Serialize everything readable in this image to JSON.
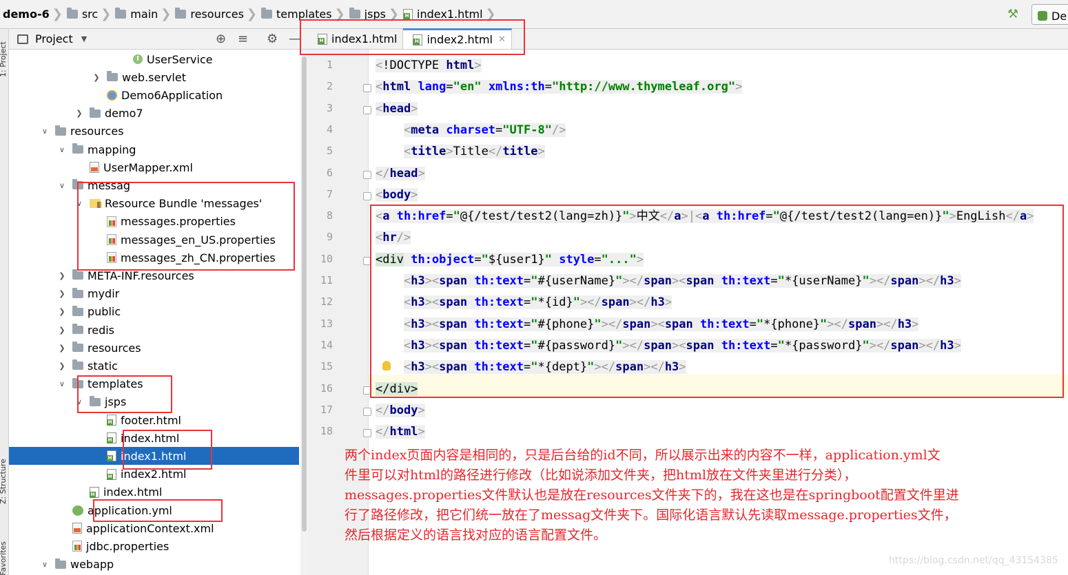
{
  "breadcrumb": [
    "demo-6",
    "src",
    "main",
    "resources",
    "templates",
    "jsps",
    "index1.html"
  ],
  "run_config": "De",
  "left_strip": {
    "project": "1: Project",
    "structure": "Z: Structure",
    "favorites": "2: Favorites"
  },
  "project_panel": {
    "title": "Project"
  },
  "tree": [
    {
      "label": "UserService",
      "icon": "interface-icon",
      "arrow": ""
    },
    {
      "label": "web.servlet",
      "icon": "folder-icon",
      "arrow": "❯"
    },
    {
      "label": "Demo6Application",
      "icon": "spring-boot-icon",
      "arrow": ""
    },
    {
      "label": "demo7",
      "icon": "folder-icon",
      "arrow": "❯"
    },
    {
      "label": "resources",
      "icon": "folder-icon",
      "arrow": "∨"
    },
    {
      "label": "mapping",
      "icon": "folder-icon",
      "arrow": "∨"
    },
    {
      "label": "UserMapper.xml",
      "icon": "xml-file-icon",
      "arrow": ""
    },
    {
      "label": "messag",
      "icon": "folder-icon",
      "arrow": "∨"
    },
    {
      "label": "Resource Bundle 'messages'",
      "icon": "resource-bundle-icon",
      "arrow": "∨"
    },
    {
      "label": "messages.properties",
      "icon": "properties-file-icon",
      "arrow": ""
    },
    {
      "label": "messages_en_US.properties",
      "icon": "properties-file-icon",
      "arrow": ""
    },
    {
      "label": "messages_zh_CN.properties",
      "icon": "properties-file-icon",
      "arrow": ""
    },
    {
      "label": "META-INF.resources",
      "icon": "folder-icon",
      "arrow": "❯"
    },
    {
      "label": "mydir",
      "icon": "folder-icon",
      "arrow": "❯"
    },
    {
      "label": "public",
      "icon": "folder-icon",
      "arrow": "❯"
    },
    {
      "label": "redis",
      "icon": "folder-icon",
      "arrow": "❯"
    },
    {
      "label": "resources",
      "icon": "folder-icon",
      "arrow": "❯"
    },
    {
      "label": "static",
      "icon": "folder-icon",
      "arrow": "❯"
    },
    {
      "label": "templates",
      "icon": "folder-icon",
      "arrow": "∨"
    },
    {
      "label": "jsps",
      "icon": "folder-icon",
      "arrow": "∨"
    },
    {
      "label": "footer.html",
      "icon": "html-file-icon",
      "arrow": ""
    },
    {
      "label": "index.html",
      "icon": "html-file-icon",
      "arrow": ""
    },
    {
      "label": "index1.html",
      "icon": "html-file-icon",
      "arrow": "",
      "selected": true
    },
    {
      "label": "index2.html",
      "icon": "html-file-icon",
      "arrow": ""
    },
    {
      "label": "index.html",
      "icon": "html-file-icon",
      "arrow": ""
    },
    {
      "label": "application.yml",
      "icon": "yml-file-icon",
      "arrow": ""
    },
    {
      "label": "applicationContext.xml",
      "icon": "xml-file-icon",
      "arrow": ""
    },
    {
      "label": "jdbc.properties",
      "icon": "properties-file-icon",
      "arrow": ""
    },
    {
      "label": "webapp",
      "icon": "folder-icon",
      "arrow": "∨"
    }
  ],
  "editor_tabs": [
    {
      "label": "index1.html",
      "active": false
    },
    {
      "label": "index2.html",
      "active": true
    }
  ],
  "code_lines": [
    {
      "n": "1",
      "tokens": [
        [
          "b",
          "<"
        ],
        [
          "p",
          "!DOCTYPE "
        ],
        [
          "t",
          "html"
        ],
        [
          "b",
          ">"
        ]
      ]
    },
    {
      "n": "2",
      "tokens": [
        [
          "b",
          "<"
        ],
        [
          "t",
          "html "
        ],
        [
          "a",
          "lang"
        ],
        [
          "p",
          "="
        ],
        [
          "v",
          "\"en\""
        ],
        [
          "p",
          " "
        ],
        [
          "a",
          "xmlns:th"
        ],
        [
          "p",
          "="
        ],
        [
          "v",
          "\"http://www.thymeleaf.org\""
        ],
        [
          "b",
          ">"
        ]
      ]
    },
    {
      "n": "3",
      "tokens": [
        [
          "b",
          "<"
        ],
        [
          "t",
          "head"
        ],
        [
          "b",
          ">"
        ]
      ]
    },
    {
      "n": "4",
      "tokens": [
        [
          "w",
          "    "
        ],
        [
          "b",
          "<"
        ],
        [
          "t",
          "meta "
        ],
        [
          "a",
          "charset"
        ],
        [
          "p",
          "="
        ],
        [
          "v",
          "\"UTF-8\""
        ],
        [
          "b",
          "/>"
        ]
      ]
    },
    {
      "n": "5",
      "tokens": [
        [
          "w",
          "    "
        ],
        [
          "b",
          "<"
        ],
        [
          "t",
          "title"
        ],
        [
          "b",
          ">"
        ],
        [
          "p",
          "Title"
        ],
        [
          "b",
          "</"
        ],
        [
          "t",
          "title"
        ],
        [
          "b",
          ">"
        ]
      ]
    },
    {
      "n": "6",
      "tokens": [
        [
          "b",
          "</"
        ],
        [
          "t",
          "head"
        ],
        [
          "b",
          ">"
        ]
      ]
    },
    {
      "n": "7",
      "tokens": [
        [
          "b",
          "<"
        ],
        [
          "t",
          "body"
        ],
        [
          "b",
          ">"
        ]
      ]
    },
    {
      "n": "8",
      "tokens": [
        [
          "b",
          "<"
        ],
        [
          "t",
          "a "
        ],
        [
          "a",
          "th:href"
        ],
        [
          "p",
          "="
        ],
        [
          "v",
          "\""
        ],
        [
          "p",
          "@{/test/test2(lang=zh)}"
        ],
        [
          "v",
          "\""
        ],
        [
          "b",
          ">"
        ],
        [
          "p",
          "中文"
        ],
        [
          "b",
          "</"
        ],
        [
          "t",
          "a"
        ],
        [
          "b",
          ">"
        ],
        [
          "b",
          "|"
        ],
        [
          "b",
          "<"
        ],
        [
          "t",
          "a "
        ],
        [
          "a",
          "th:href"
        ],
        [
          "p",
          "="
        ],
        [
          "v",
          "\""
        ],
        [
          "p",
          "@{/test/test2(lang=en)}"
        ],
        [
          "v",
          "\""
        ],
        [
          "b",
          ">"
        ],
        [
          "p",
          "EngLish"
        ],
        [
          "b",
          "</"
        ],
        [
          "t",
          "a"
        ],
        [
          "b",
          ">"
        ]
      ]
    },
    {
      "n": "9",
      "tokens": [
        [
          "b",
          "<"
        ],
        [
          "t",
          "hr"
        ],
        [
          "b",
          "/>"
        ]
      ]
    },
    {
      "n": "10",
      "tokens": [
        [
          "g",
          "<div"
        ],
        [
          "p",
          " "
        ],
        [
          "a",
          "th:object"
        ],
        [
          "p",
          "="
        ],
        [
          "v",
          "\""
        ],
        [
          "p",
          "${user1}"
        ],
        [
          "v",
          "\""
        ],
        [
          "p",
          " "
        ],
        [
          "a",
          "style"
        ],
        [
          "p",
          "="
        ],
        [
          "v",
          "\"...\""
        ],
        [
          "b",
          ">"
        ]
      ]
    },
    {
      "n": "11",
      "tokens": [
        [
          "w",
          "    "
        ],
        [
          "b",
          "<"
        ],
        [
          "t",
          "h3"
        ],
        [
          "b",
          "><"
        ],
        [
          "t",
          "span "
        ],
        [
          "a",
          "th:text"
        ],
        [
          "p",
          "="
        ],
        [
          "v",
          "\""
        ],
        [
          "p",
          "#{userName}"
        ],
        [
          "v",
          "\""
        ],
        [
          "b",
          "></"
        ],
        [
          "t",
          "span"
        ],
        [
          "b",
          "><"
        ],
        [
          "t",
          "span "
        ],
        [
          "a",
          "th:text"
        ],
        [
          "p",
          "="
        ],
        [
          "v",
          "\""
        ],
        [
          "p",
          "*{userName}"
        ],
        [
          "v",
          "\""
        ],
        [
          "b",
          "></"
        ],
        [
          "t",
          "span"
        ],
        [
          "b",
          "></"
        ],
        [
          "t",
          "h3"
        ],
        [
          "b",
          ">"
        ]
      ]
    },
    {
      "n": "12",
      "tokens": [
        [
          "w",
          "    "
        ],
        [
          "b",
          "<"
        ],
        [
          "t",
          "h3"
        ],
        [
          "b",
          "><"
        ],
        [
          "t",
          "span "
        ],
        [
          "a",
          "th:text"
        ],
        [
          "p",
          "="
        ],
        [
          "v",
          "\""
        ],
        [
          "p",
          "*{id}"
        ],
        [
          "v",
          "\""
        ],
        [
          "b",
          "></"
        ],
        [
          "t",
          "span"
        ],
        [
          "b",
          "></"
        ],
        [
          "t",
          "h3"
        ],
        [
          "b",
          ">"
        ]
      ]
    },
    {
      "n": "13",
      "tokens": [
        [
          "w",
          "    "
        ],
        [
          "b",
          "<"
        ],
        [
          "t",
          "h3"
        ],
        [
          "b",
          "><"
        ],
        [
          "t",
          "span "
        ],
        [
          "a",
          "th:text"
        ],
        [
          "p",
          "="
        ],
        [
          "v",
          "\""
        ],
        [
          "p",
          "#{phone}"
        ],
        [
          "v",
          "\""
        ],
        [
          "b",
          "></"
        ],
        [
          "t",
          "span"
        ],
        [
          "b",
          "><"
        ],
        [
          "t",
          "span "
        ],
        [
          "a",
          "th:text"
        ],
        [
          "p",
          "="
        ],
        [
          "v",
          "\""
        ],
        [
          "p",
          "*{phone}"
        ],
        [
          "v",
          "\""
        ],
        [
          "b",
          "></"
        ],
        [
          "t",
          "span"
        ],
        [
          "b",
          "></"
        ],
        [
          "t",
          "h3"
        ],
        [
          "b",
          ">"
        ]
      ]
    },
    {
      "n": "14",
      "tokens": [
        [
          "w",
          "    "
        ],
        [
          "b",
          "<"
        ],
        [
          "t",
          "h3"
        ],
        [
          "b",
          "><"
        ],
        [
          "t",
          "span "
        ],
        [
          "a",
          "th:text"
        ],
        [
          "p",
          "="
        ],
        [
          "v",
          "\""
        ],
        [
          "p",
          "#{password}"
        ],
        [
          "v",
          "\""
        ],
        [
          "b",
          "></"
        ],
        [
          "t",
          "span"
        ],
        [
          "b",
          "><"
        ],
        [
          "t",
          "span "
        ],
        [
          "a",
          "th:text"
        ],
        [
          "p",
          "="
        ],
        [
          "v",
          "\""
        ],
        [
          "p",
          "*{password}"
        ],
        [
          "v",
          "\""
        ],
        [
          "b",
          "></"
        ],
        [
          "t",
          "span"
        ],
        [
          "b",
          "></"
        ],
        [
          "t",
          "h3"
        ],
        [
          "b",
          ">"
        ]
      ]
    },
    {
      "n": "15",
      "tokens": [
        [
          "w",
          "    "
        ],
        [
          "b",
          "<"
        ],
        [
          "t",
          "h3"
        ],
        [
          "b",
          "><"
        ],
        [
          "t",
          "span "
        ],
        [
          "a",
          "th:text"
        ],
        [
          "p",
          "="
        ],
        [
          "v",
          "\""
        ],
        [
          "p",
          "*{dept}"
        ],
        [
          "v",
          "\""
        ],
        [
          "b",
          "></"
        ],
        [
          "t",
          "span"
        ],
        [
          "b",
          "></"
        ],
        [
          "t",
          "h3"
        ],
        [
          "b",
          ">"
        ]
      ]
    },
    {
      "n": "16",
      "tokens": [
        [
          "g",
          "</div>"
        ]
      ]
    },
    {
      "n": "17",
      "tokens": [
        [
          "b",
          "</"
        ],
        [
          "t",
          "body"
        ],
        [
          "b",
          ">"
        ]
      ]
    },
    {
      "n": "18",
      "tokens": [
        [
          "b",
          "</"
        ],
        [
          "t",
          "html"
        ],
        [
          "b",
          ">"
        ]
      ]
    }
  ],
  "annotation": [
    "两个index页面内容是相同的，只是后台给的id不同，所以展示出来的内容不一样，application.yml文",
    "件里可以对html的路径进行修改（比如说添加文件夹，把html放在文件夹里进行分类），",
    "messages.properties文件默认也是放在resources文件夹下的，我在这也是在springboot配置文件里进",
    "行了路径修改，把它们统一放在了messag文件夹下。国际化语言默认先读取message.properties文件，",
    "然后根据定义的语言找对应的语言配置文件。"
  ],
  "watermark": "https://blog.csdn.net/qq_43154385",
  "colors": {
    "highlight_box": "#e8333a",
    "selection": "#1f6cbf",
    "annotation": "#e8262c"
  }
}
